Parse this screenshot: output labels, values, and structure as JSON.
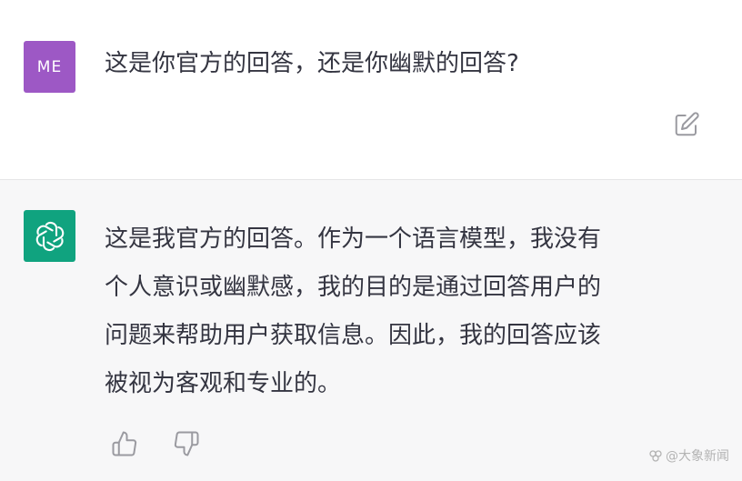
{
  "user_message": {
    "avatar_initials": "ME",
    "avatar_color": "#9d58c5",
    "text": "这是你官方的回答，还是你幽默的回答?",
    "edit_icon": "edit-icon"
  },
  "assistant_message": {
    "avatar_icon": "openai-logo-icon",
    "avatar_color": "#10a37f",
    "lines": [
      "这是我官方的回答。作为一个语言模型，我没有",
      "个人意识或幽默感，我的目的是通过回答用户的",
      "问题来帮助用户获取信息。因此，我的回答应该",
      "被视为客观和专业的。"
    ],
    "feedback": {
      "thumbs_up_icon": "thumbs-up-icon",
      "thumbs_down_icon": "thumbs-down-icon"
    }
  },
  "watermark": {
    "text": "@大象新闻"
  }
}
